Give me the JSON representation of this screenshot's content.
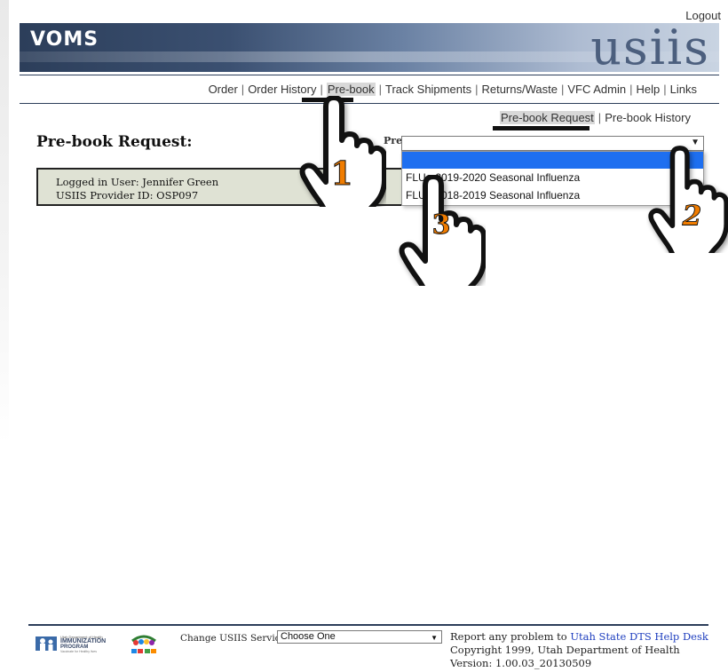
{
  "header": {
    "logout": "Logout",
    "brand": "VOMS",
    "usiis_logo": "usiis"
  },
  "nav": {
    "items": [
      "Order",
      "Order History",
      "Pre-book",
      "Track Shipments",
      "Returns/Waste",
      "VFC Admin",
      "Help",
      "Links"
    ],
    "separator": "|",
    "active": "Pre-book"
  },
  "subnav": {
    "request": "Pre-book Request",
    "history": "Pre-book History",
    "separator": "|"
  },
  "page": {
    "title": "Pre-book Request:",
    "select_label_partial": "Pre"
  },
  "user": {
    "logged_in": "Logged in User: Jennifer Green",
    "provider_id": "USIIS Provider ID: OSP097"
  },
  "prebook_select": {
    "value": "",
    "options": [
      "",
      "FLU - 2019-2020 Seasonal Influenza",
      "FLU - 2018-2019 Seasonal Influenza"
    ]
  },
  "annotations": {
    "step1": "1",
    "step2": "2",
    "step3": "3",
    "accent": "#f07c00"
  },
  "footer": {
    "logo_small": "Utah Department of Health",
    "logo_main1": "IMMUNIZATION",
    "logo_main2": "PROGRAM",
    "logo_tagline": "Vaccinate for Healthy lives",
    "change_label": "Change USIIS Service:",
    "change_value": "Choose One",
    "report_prefix": "Report any problem to",
    "report_link": "Utah State DTS Help Desk",
    "copyright": "Copyright 1999, Utah Department of Health",
    "version": "Version: 1.00.03_20130509"
  }
}
